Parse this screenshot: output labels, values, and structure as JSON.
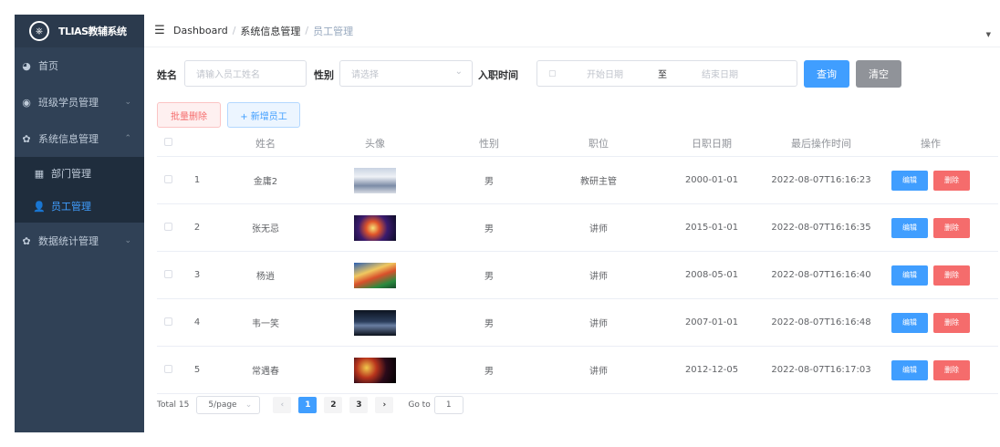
{
  "app": {
    "logo_glyph": "⎈",
    "title": "TLIAS教辅系统"
  },
  "sidebar": {
    "items": [
      {
        "label": "首页",
        "icon": "dashboard-icon",
        "glyph": "◕"
      },
      {
        "label": "班级学员管理",
        "icon": "student-icon",
        "glyph": "◉",
        "arrow": "⌄"
      },
      {
        "label": "系统信息管理",
        "icon": "gear-icon",
        "glyph": "✿",
        "arrow": "⌃"
      },
      {
        "label": "数据统计管理",
        "icon": "gear-icon",
        "glyph": "✿",
        "arrow": "⌄"
      }
    ],
    "subitems": [
      {
        "label": "部门管理",
        "icon": "grid-icon",
        "glyph": "▦"
      },
      {
        "label": "员工管理",
        "icon": "user-icon",
        "glyph": "👤"
      }
    ]
  },
  "navbar": {
    "hamburger": "☰",
    "crumbs": [
      "Dashboard",
      "系统信息管理",
      "员工管理"
    ],
    "sep": "/",
    "dropdown": "▼"
  },
  "search": {
    "name_label": "姓名",
    "name_placeholder": "请输入员工姓名",
    "gender_label": "性别",
    "gender_placeholder": "请选择",
    "gender_arrow": "⌄",
    "date_label": "入职时间",
    "date_icon": "▢",
    "start_placeholder": "开始日期",
    "range_sep": "至",
    "end_placeholder": "结束日期",
    "query_label": "查询",
    "clear_label": "清空"
  },
  "toolbar": {
    "batch_delete": "批量删除",
    "add": "+ 新增员工"
  },
  "table": {
    "headers": [
      "姓名",
      "头像",
      "性别",
      "职位",
      "日职日期",
      "最后操作时间",
      "操作"
    ],
    "edit_label": "编辑",
    "delete_label": "删除",
    "rows": [
      {
        "id": "1",
        "name": "金庸2",
        "gender": "男",
        "position": "教研主管",
        "date": "2000-01-01",
        "updated": "2022-08-07T16:16:23"
      },
      {
        "id": "2",
        "name": "张无忌",
        "gender": "男",
        "position": "讲师",
        "date": "2015-01-01",
        "updated": "2022-08-07T16:16:35"
      },
      {
        "id": "3",
        "name": "杨逍",
        "gender": "男",
        "position": "讲师",
        "date": "2008-05-01",
        "updated": "2022-08-07T16:16:40"
      },
      {
        "id": "4",
        "name": "韦一笑",
        "gender": "男",
        "position": "讲师",
        "date": "2007-01-01",
        "updated": "2022-08-07T16:16:48"
      },
      {
        "id": "5",
        "name": "常遇春",
        "gender": "男",
        "position": "讲师",
        "date": "2012-12-05",
        "updated": "2022-08-07T16:17:03"
      }
    ]
  },
  "pagination": {
    "total": "Total 15",
    "page_size": "5/page",
    "size_arrow": "⌄",
    "prev": "‹",
    "next": "›",
    "pages": [
      "1",
      "2",
      "3"
    ],
    "goto_label": "Go to",
    "goto_value": "1"
  },
  "colors": {
    "primary": "#409eff",
    "danger": "#f56c6c",
    "sidebar_bg": "#304156",
    "submenu_bg": "#1f2d3d"
  }
}
